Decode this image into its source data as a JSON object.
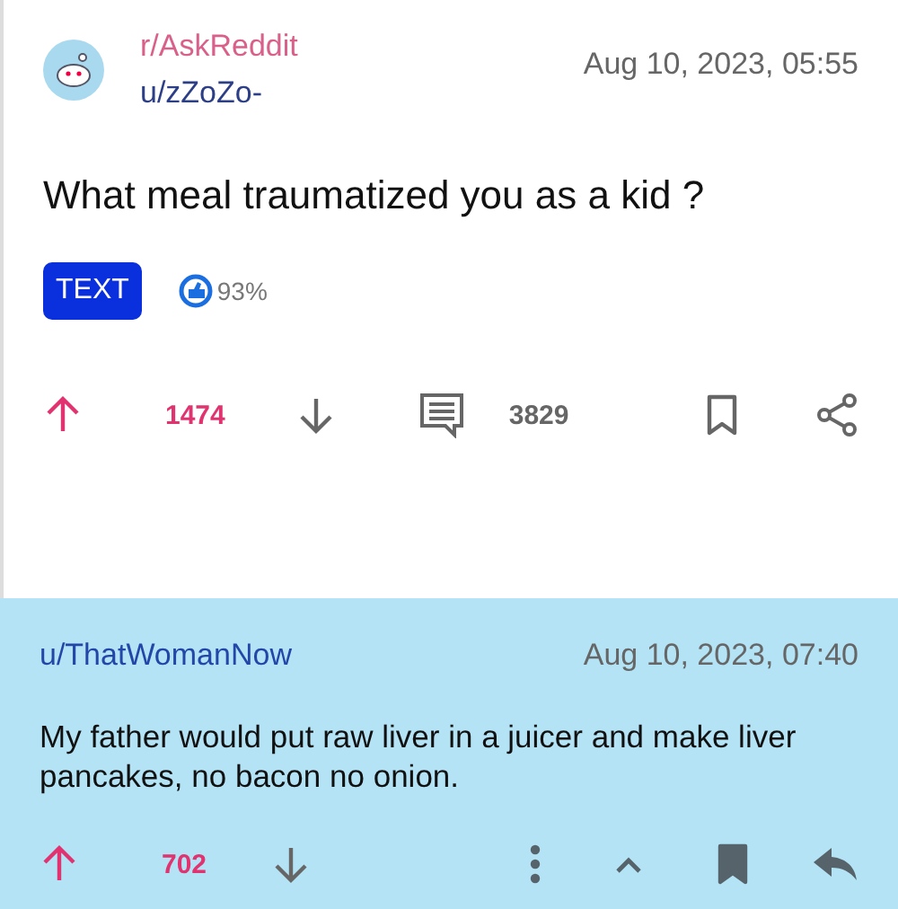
{
  "post": {
    "subreddit": "r/AskReddit",
    "author": "u/zZoZo-",
    "date": "Aug 10, 2023, 05:55",
    "title": "What meal traumatized you as a kid ?",
    "flair": "TEXT",
    "upvote_ratio": "93%",
    "upvoted": true,
    "score": "1474",
    "comments": "3829",
    "saved": false
  },
  "comment": {
    "author": "u/ThatWomanNow",
    "date": "Aug 10, 2023, 07:40",
    "body": "My father would put raw liver in a juicer and make liver pancakes, no bacon no onion.",
    "upvoted": true,
    "score": "702",
    "saved": true
  }
}
